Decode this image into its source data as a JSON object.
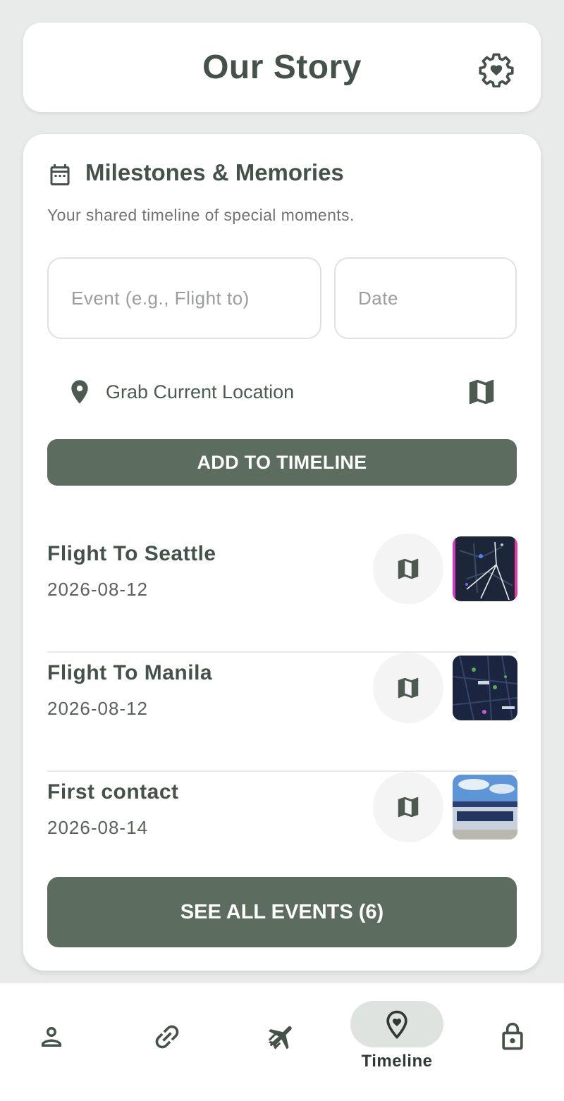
{
  "header": {
    "title": "Our Story",
    "settings_icon": "settings-heart-icon"
  },
  "milestones": {
    "title": "Milestones & Memories",
    "subtitle": "Your shared timeline of special moments.",
    "event_placeholder": "Event (e.g., Flight to)",
    "date_placeholder": "Date",
    "location_label": "Grab Current Location",
    "add_button": "ADD TO TIMELINE",
    "events": [
      {
        "title": "Flight To Seattle",
        "date": "2026-08-12"
      },
      {
        "title": "Flight To Manila",
        "date": "2026-08-12"
      },
      {
        "title": "First contact",
        "date": "2026-08-14"
      }
    ],
    "see_all_button": "SEE ALL EVENTS (6)"
  },
  "nav": {
    "items": [
      {
        "icon": "person-icon",
        "label": ""
      },
      {
        "icon": "link-icon",
        "label": ""
      },
      {
        "icon": "flight-icon",
        "label": ""
      },
      {
        "icon": "location-heart-icon",
        "label": "Timeline"
      },
      {
        "icon": "lock-icon",
        "label": ""
      }
    ],
    "active": "Timeline"
  },
  "colors": {
    "primary": "#5c6c5e",
    "text": "#45524a",
    "background": "#e9eaea"
  }
}
